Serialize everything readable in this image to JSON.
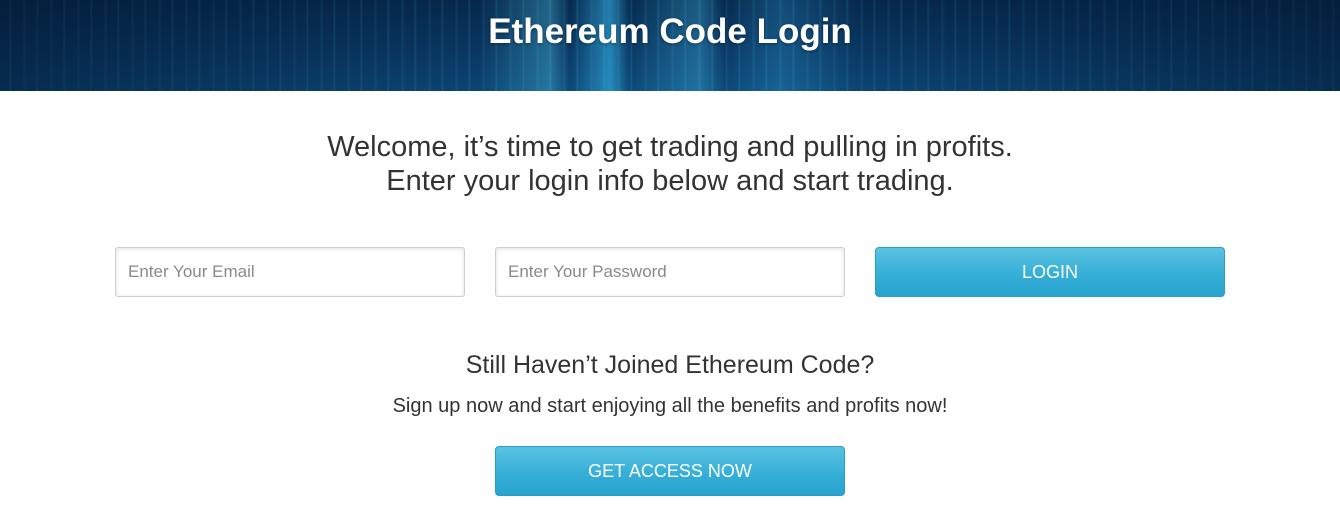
{
  "header": {
    "title": "Ethereum Code Login"
  },
  "welcome": {
    "line1": "Welcome, it’s time to get trading and pulling in profits.",
    "line2": "Enter your login info below and start trading."
  },
  "login_form": {
    "email_placeholder": "Enter Your Email",
    "email_value": "",
    "password_placeholder": "Enter Your Password",
    "password_value": "",
    "login_label": "LOGIN"
  },
  "signup": {
    "title": "Still Haven’t Joined Ethereum Code?",
    "subtitle": "Sign up now and start enjoying all the benefits and profits now!",
    "cta_label": "GET ACCESS NOW"
  },
  "colors": {
    "header_bg": "#0a3a66",
    "button_bg": "#36afd7",
    "text": "#333333"
  }
}
